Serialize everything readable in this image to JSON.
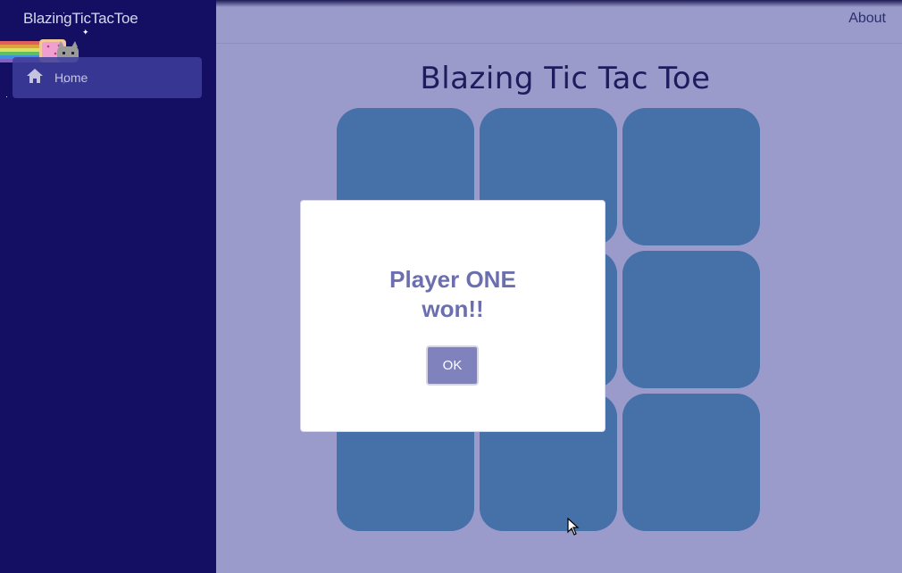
{
  "app": {
    "brand": "BlazingTicTacToe"
  },
  "sidebar": {
    "items": [
      {
        "label": "Home",
        "icon": "home-icon",
        "active": true
      }
    ]
  },
  "topbar": {
    "about_label": "About"
  },
  "main": {
    "title": "Blazing Tic Tac Toe",
    "board": {
      "rows": 3,
      "cols": 3,
      "cells": [
        "",
        "",
        "",
        "",
        "",
        "",
        "",
        "",
        ""
      ]
    }
  },
  "modal": {
    "message": "Player ONE won!!",
    "ok_label": "OK"
  },
  "colors": {
    "sidebar_bg": "#150f63",
    "page_bg": "#9a9acb",
    "cell_bg": "#4670a8",
    "accent": "#6b6fb0",
    "button_bg": "#7f82bd"
  }
}
